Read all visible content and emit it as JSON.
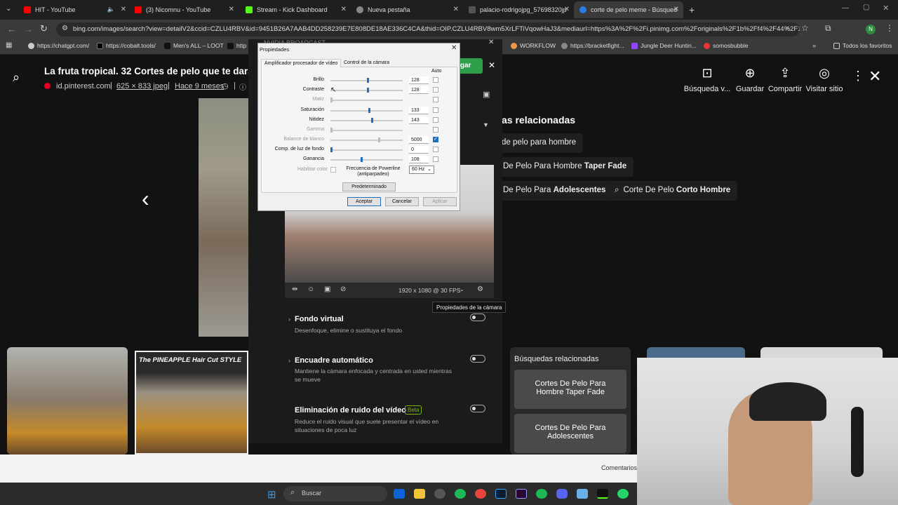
{
  "tabs": [
    {
      "title": "HIT - YouTube",
      "color": "#ff0000"
    },
    {
      "title": "(3) Nicomnu - YouTube",
      "color": "#ff0000"
    },
    {
      "title": "Stream - Kick Dashboard",
      "color": "#53fc18"
    },
    {
      "title": "Nueva pestaña",
      "color": "#dddddd"
    },
    {
      "title": "palacio-rodrigojpg_57698320jp",
      "color": "#999999"
    },
    {
      "title": "corte de pelo meme - Búsqued",
      "color": "#2b7de9"
    }
  ],
  "url": "bing.com/images/search?view=detailV2&ccid=CZLU4RBV&id=9451B26A7AAB4DD258239E7E808DE18AE336C4CA&thid=OIP.CZLU4RBV8wm5XrLFTiVqowHaJ3&mediaurl=https%3A%2F%2Fi.pinimg.com%2Foriginals%2F1b%2Ff4%2F44%2F1b...",
  "bookmarks": [
    "https://chatgpt.com/",
    "https://cobalt.tools/",
    "Men's ALL – LOOT",
    "http",
    "WORKFLOW",
    "https://bracketfight...",
    "Jungle Deer Huntin...",
    "somosbubble",
    "Todos los favoritos"
  ],
  "bing": {
    "title": "La fruta tropical. 32 Cortes de pelo que te dará",
    "source": "id.pinterest.com",
    "size": "625 × 833 jpeg",
    "age": "Hace 9 meses",
    "download": "rgar",
    "toolbar": [
      "Búsqueda v...",
      "Guardar",
      "Compartir",
      "Visitar sitio"
    ],
    "related_title": "as relacionadas",
    "chips": [
      "de pelo para hombre",
      "De Pelo Para Hombre ",
      "Taper Fade",
      "De Pelo Para ",
      "Adolescentes",
      "Corte De Pelo ",
      "Corto Hombre"
    ],
    "thumb_caption": "The PINEAPPLE Hair Cut STYLE",
    "related2_title": "Búsquedas relacionadas",
    "card1": "Cortes De Pelo Para Hombre Taper Fade",
    "card2": "Cortes De Pelo Para Adolescentes",
    "comments": "Comentarios"
  },
  "nvidia": {
    "title": "NVIDIA BROADCAST",
    "resolution": "1920 x 1080 @ 30 FPS",
    "tooltip": "Propiedades de la cámara",
    "sections": [
      {
        "title": "Fondo virtual",
        "desc": "Desenfoque, elimine o sustituya el fondo"
      },
      {
        "title": "Encuadre automático",
        "desc": "Mantiene la cámara enfocada y centrada en usted mientras se mueve"
      },
      {
        "title": "Eliminación de ruido del vídeo",
        "desc": "Reduce el ruido visual que suele presentar el vídeo en situaciones de poca luz",
        "badge": "Beta"
      }
    ]
  },
  "dialog": {
    "title": "Propiedades",
    "tabs": [
      "Amplificador procesador de vídeo",
      "Control de la cámara"
    ],
    "auto": "Auto",
    "rows": [
      {
        "label": "Brillo",
        "value": "128",
        "pos": 0.5,
        "enabled": true,
        "auto": false
      },
      {
        "label": "Contraste",
        "value": "128",
        "pos": 0.5,
        "enabled": true,
        "auto": false
      },
      {
        "label": "Matiz",
        "value": "",
        "pos": 0.0,
        "enabled": false,
        "auto": false
      },
      {
        "label": "Saturación",
        "value": "133",
        "pos": 0.52,
        "enabled": true,
        "auto": false
      },
      {
        "label": "Nitidez",
        "value": "143",
        "pos": 0.56,
        "enabled": true,
        "auto": false
      },
      {
        "label": "Gamma",
        "value": "",
        "pos": 0.0,
        "enabled": false,
        "auto": false
      },
      {
        "label": "Balance de blanco",
        "value": "5000",
        "pos": 0.66,
        "enabled": false,
        "auto": true
      },
      {
        "label": "Comp. de luz de fondo",
        "value": "0",
        "pos": 0.0,
        "enabled": true,
        "auto": false
      },
      {
        "label": "Ganancia",
        "value": "108",
        "pos": 0.42,
        "enabled": true,
        "auto": false
      }
    ],
    "color_label": "Habilitar color",
    "powerline_label": "Frecuencia de Powerline (antiparpadeo)",
    "powerline_value": "60 Hz",
    "default_btn": "Predeterminado",
    "ok": "Aceptar",
    "cancel": "Cancelar",
    "apply": "Aplicar"
  },
  "taskbar": {
    "search": "Buscar"
  }
}
